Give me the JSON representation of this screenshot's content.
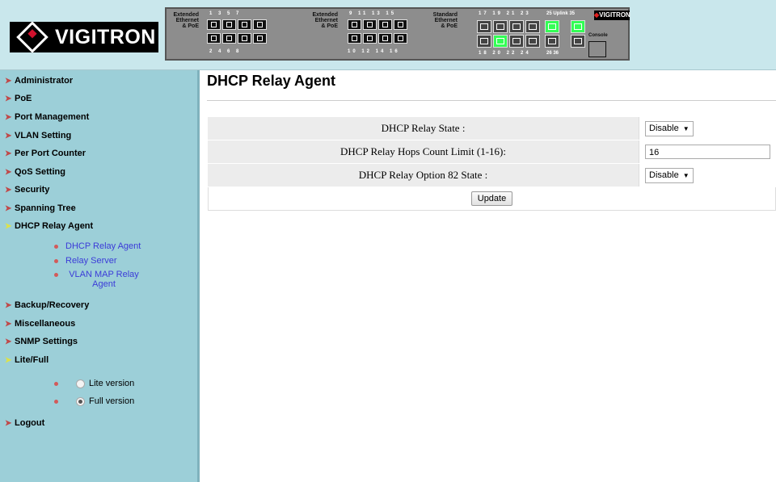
{
  "brand": {
    "logo_text": "VIGITRON",
    "mini_logo": "VIGITRON"
  },
  "panel": {
    "group1_label": [
      "Extended",
      "Ethernet",
      "& PoE"
    ],
    "group2_label": [
      "Extended",
      "Ethernet",
      "& PoE"
    ],
    "group3_label": [
      "Standard",
      "Ethernet",
      "& PoE"
    ],
    "g1_top": "1  3  5  7",
    "g1_bot": "2  4  6  8",
    "g2_top": "9  11  13  15",
    "g2_bot": "10  12  14  16",
    "g3_top": "17  19  21  23",
    "g3_bot": "18  20  22  24",
    "uplink_top": "25 Uplink 35",
    "uplink_bot": "26      36",
    "console": "Console"
  },
  "sidebar": {
    "items": [
      {
        "label": "Administrator"
      },
      {
        "label": "PoE"
      },
      {
        "label": "Port Management"
      },
      {
        "label": "VLAN Setting"
      },
      {
        "label": "Per Port Counter"
      },
      {
        "label": "QoS Setting"
      },
      {
        "label": "Security"
      },
      {
        "label": "Spanning Tree"
      },
      {
        "label": "DHCP Relay Agent"
      },
      {
        "label": "Backup/Recovery"
      },
      {
        "label": "Miscellaneous"
      },
      {
        "label": "SNMP Settings"
      },
      {
        "label": "Lite/Full"
      },
      {
        "label": "Logout"
      }
    ],
    "dhcp_sub": [
      {
        "label": "DHCP Relay Agent"
      },
      {
        "label": "Relay Server"
      },
      {
        "label": "VLAN MAP Relay Agent"
      }
    ],
    "lite_full": [
      {
        "label": "Lite version",
        "checked": false
      },
      {
        "label": "Full version",
        "checked": true
      }
    ]
  },
  "main": {
    "title": "DHCP Relay Agent",
    "rows": [
      {
        "label": "DHCP Relay State :",
        "value": "Disable"
      },
      {
        "label": "DHCP Relay Hops Count Limit (1-16):",
        "value": "16"
      },
      {
        "label": "DHCP Relay Option 82 State :",
        "value": "Disable"
      }
    ],
    "update_label": "Update"
  }
}
